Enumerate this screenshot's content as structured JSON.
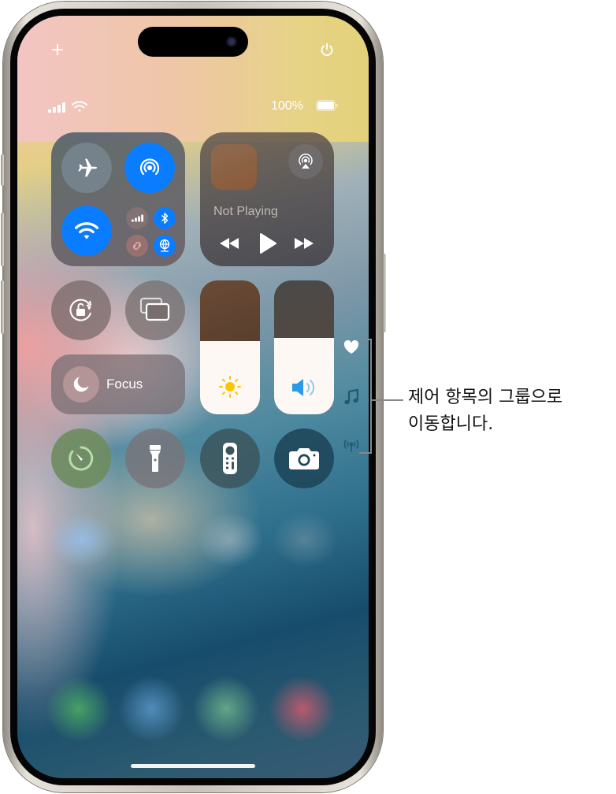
{
  "device": "iPhone",
  "top_controls": {
    "add_icon": "plus-icon",
    "power_icon": "power-icon"
  },
  "status_bar": {
    "battery_percent": "100%",
    "signal_icon": "cellular-signal-icon",
    "wifi_icon": "wifi-icon",
    "battery_icon": "battery-icon"
  },
  "connectivity": {
    "airplane_mode": {
      "label": "Airplane Mode",
      "on": false
    },
    "airdrop": {
      "label": "AirDrop",
      "on": true
    },
    "wifi": {
      "label": "Wi-Fi",
      "on": true
    },
    "cellular": {
      "label": "Cellular Data",
      "on": false
    },
    "bluetooth": {
      "label": "Bluetooth",
      "on": true
    },
    "personal_hotspot": {
      "label": "Personal Hotspot",
      "on": false
    },
    "vpn": {
      "label": "VPN / Network",
      "on": true
    }
  },
  "now_playing": {
    "status": "Not Playing",
    "airplay_icon": "airplay-audio-icon",
    "controls": [
      "rewind",
      "play",
      "fast-forward"
    ]
  },
  "controls": {
    "orientation_lock": "Orientation Lock",
    "screen_mirroring": "Screen Mirroring",
    "focus_label": "Focus",
    "brightness_level": 0.55,
    "volume_level": 0.57,
    "timer": "Timer",
    "flashlight": "Flashlight",
    "remote": "Apple TV Remote",
    "camera": "Camera"
  },
  "page_groups": [
    {
      "name": "favorites",
      "icon": "heart-icon"
    },
    {
      "name": "music",
      "icon": "music-note-icon"
    },
    {
      "name": "connectivity",
      "icon": "antenna-icon"
    }
  ],
  "callout": {
    "line1": "제어 항목의 그룹으로",
    "line2": "이동합니다."
  },
  "colors": {
    "accent_blue": "#0a7cff",
    "timer_green": "#6f8f5f",
    "brightness_sun": "#ffc400",
    "volume_speaker": "#2c9be6"
  }
}
